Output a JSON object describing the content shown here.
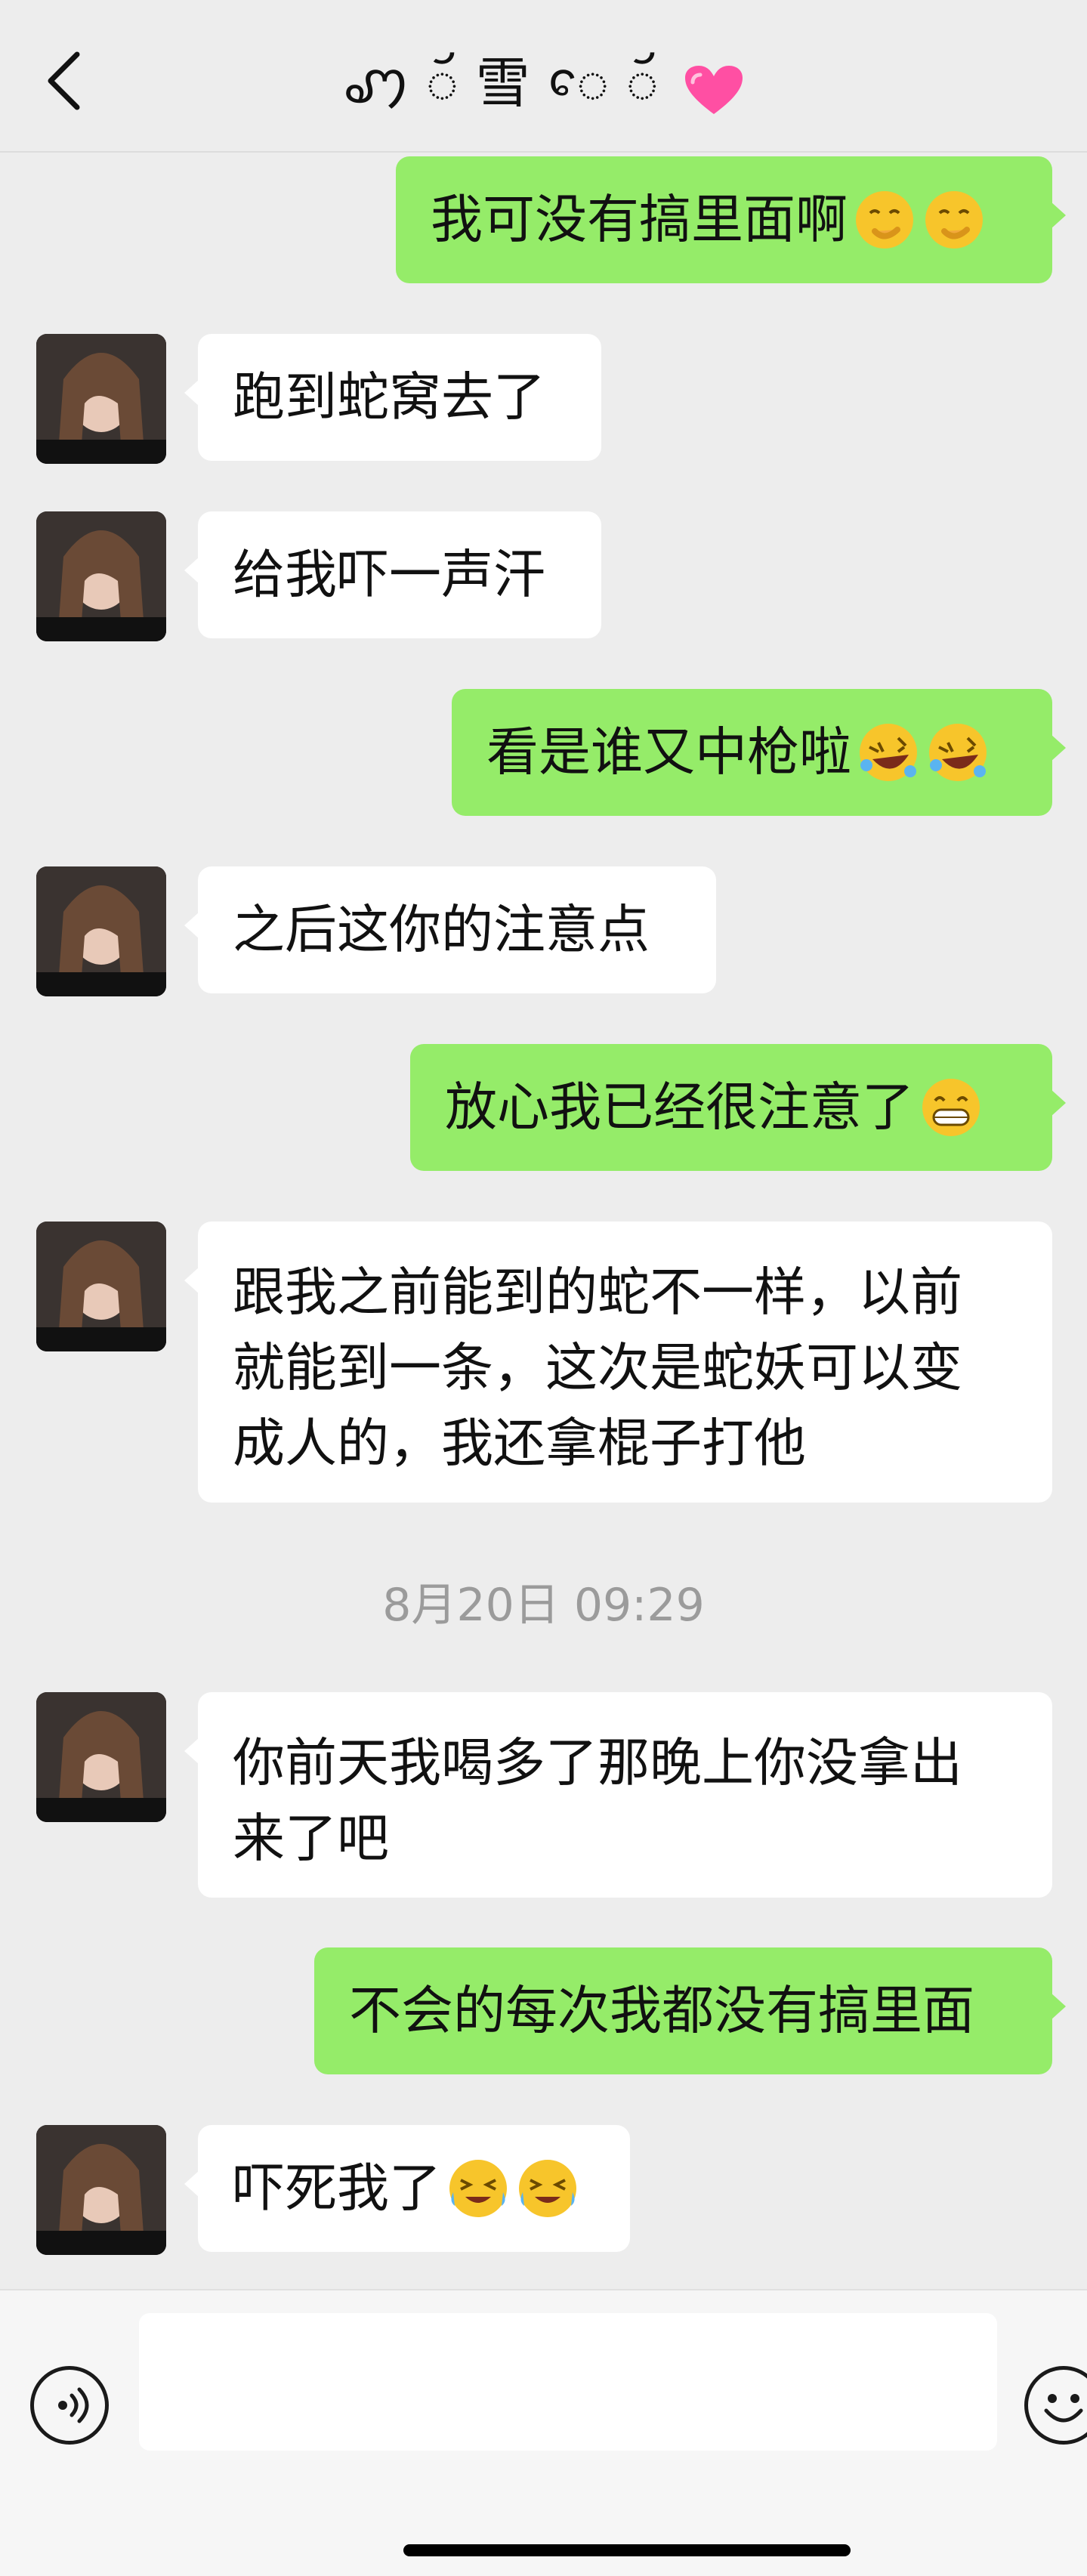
{
  "header": {
    "title": "ꩇ ◌ꨮ 雪 ꨯ ◌ꨮ",
    "back_icon": "chevron-left-icon",
    "title_emoji": "sparkling-heart-emoji"
  },
  "messages": [
    {
      "id": "m1",
      "side": "out",
      "text": "我可没有搞里面啊",
      "emojis": [
        "hand-over-mouth-emoji",
        "hand-over-mouth-emoji"
      ]
    },
    {
      "id": "m2",
      "side": "in",
      "text": "跑到蛇窝去了",
      "emojis": []
    },
    {
      "id": "m3",
      "side": "in",
      "text": "给我吓一声汗",
      "emojis": []
    },
    {
      "id": "m4",
      "side": "out",
      "text": "看是谁又中枪啦",
      "emojis": [
        "rolling-laughing-emoji",
        "rolling-laughing-emoji"
      ]
    },
    {
      "id": "m5",
      "side": "in",
      "text": "之后这你的注意点",
      "emojis": []
    },
    {
      "id": "m6",
      "side": "out",
      "text": "放心我已经很注意了",
      "emojis": [
        "grinning-emoji"
      ]
    },
    {
      "id": "m7",
      "side": "in",
      "lines": [
        "跟我之前能到的蛇不一样，以前",
        "就能到一条，这次是蛇妖可以变",
        "成人的，我还拿棍子打他"
      ],
      "emojis": []
    },
    {
      "id": "m8",
      "side": "in",
      "lines": [
        "你前天我喝多了那晚上你没拿出",
        "来了吧"
      ],
      "emojis": []
    },
    {
      "id": "m9",
      "side": "out",
      "text": "不会的每次我都没有搞里面",
      "emojis": []
    },
    {
      "id": "m10",
      "side": "in",
      "text": "吓死我了",
      "emojis": [
        "crying-laughing-emoji",
        "crying-laughing-emoji"
      ]
    }
  ],
  "timestamp": "8月20日 09:29",
  "input": {
    "value": "",
    "placeholder": "",
    "voice_icon": "voice-input-icon",
    "emoji_icon": "emoji-picker-icon"
  },
  "colors": {
    "background": "#ededed",
    "outgoing_bubble": "#95ec69",
    "incoming_bubble": "#ffffff",
    "timestamp_text": "#9b9b9b"
  }
}
